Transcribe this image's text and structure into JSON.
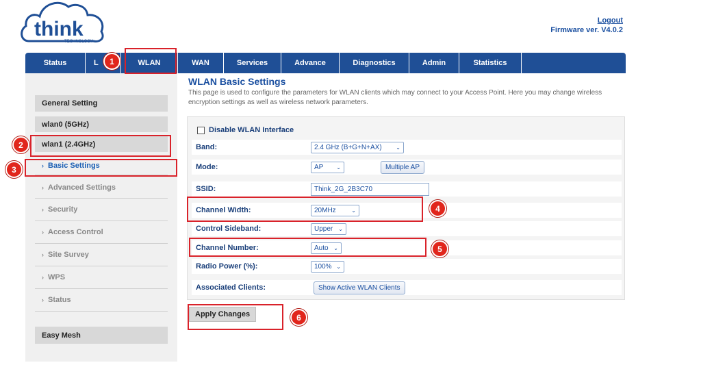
{
  "brand": {
    "name": "think",
    "sub": "TECHNOLOGY",
    "color": "#1f4f96"
  },
  "header": {
    "logout": "Logout",
    "firmware": "Firmware ver. V4.0.2"
  },
  "nav": [
    {
      "label": "Status"
    },
    {
      "label": "L"
    },
    {
      "label": "WLAN"
    },
    {
      "label": "WAN"
    },
    {
      "label": "Services"
    },
    {
      "label": "Advance"
    },
    {
      "label": "Diagnostics"
    },
    {
      "label": "Admin"
    },
    {
      "label": "Statistics"
    }
  ],
  "sidebar": {
    "general": "General Setting",
    "wlan0": "wlan0 (5GHz)",
    "wlan1": "wlan1 (2.4GHz)",
    "items": [
      {
        "label": "Basic Settings"
      },
      {
        "label": "Advanced Settings"
      },
      {
        "label": "Security"
      },
      {
        "label": "Access Control"
      },
      {
        "label": "Site Survey"
      },
      {
        "label": "WPS"
      },
      {
        "label": "Status"
      }
    ],
    "easy_mesh": "Easy Mesh"
  },
  "main": {
    "title": "WLAN Basic Settings",
    "description": "This page is used to configure the parameters for WLAN clients which may connect to your Access Point. Here you may change wireless encryption settings as well as wireless network parameters.",
    "disable_label": "Disable WLAN Interface",
    "rows": {
      "band": {
        "label": "Band:",
        "value": "2.4 GHz (B+G+N+AX)"
      },
      "mode": {
        "label": "Mode:",
        "value": "AP",
        "button": "Multiple AP"
      },
      "ssid": {
        "label": "SSID:",
        "value": "Think_2G_2B3C70"
      },
      "channel_width": {
        "label": "Channel Width:",
        "value": "20MHz"
      },
      "sideband": {
        "label": "Control Sideband:",
        "value": "Upper"
      },
      "channel_number": {
        "label": "Channel Number:",
        "value": "Auto"
      },
      "radio_power": {
        "label": "Radio Power (%):",
        "value": "100%"
      },
      "clients": {
        "label": "Associated Clients:",
        "button": "Show Active WLAN Clients"
      }
    },
    "apply": "Apply Changes"
  },
  "annotations": [
    "1",
    "2",
    "3",
    "4",
    "5",
    "6"
  ],
  "colors": {
    "annotation": "#e1261c",
    "nav_bg": "#1f4f96",
    "link": "#1a4fa0"
  }
}
